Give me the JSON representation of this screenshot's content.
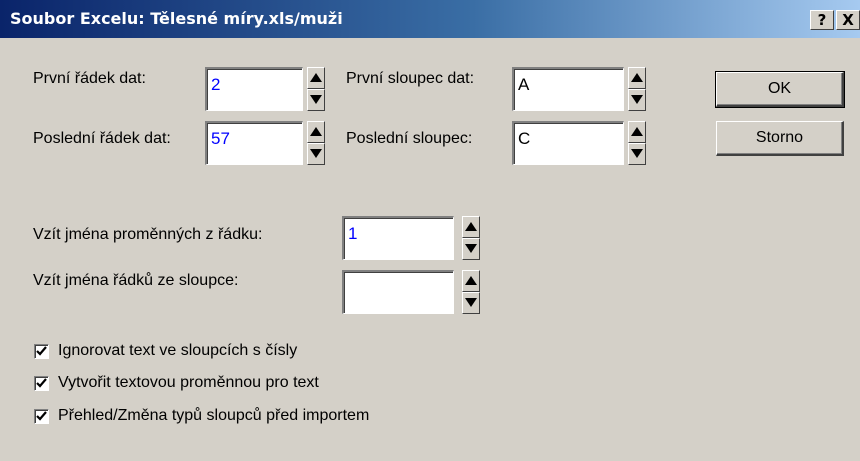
{
  "window": {
    "title": "Soubor Excelu: Tělesné míry.xls/muži",
    "help_label": "?",
    "close_label": "X"
  },
  "fields": {
    "first_row": {
      "label": "První řádek dat:",
      "value": "2"
    },
    "last_row": {
      "label": "Poslední řádek dat:",
      "value": "57"
    },
    "first_column": {
      "label": "První sloupec dat:",
      "value": "A"
    },
    "last_column": {
      "label": "Poslední sloupec:",
      "value": "C"
    },
    "var_names_row": {
      "label": "Vzít jména proměnných z řádku:",
      "value": "1"
    },
    "row_names_column": {
      "label": "Vzít jména řádků ze sloupce:",
      "value": ""
    }
  },
  "buttons": {
    "ok": "OK",
    "cancel": "Storno"
  },
  "checkboxes": [
    {
      "label": "Ignorovat text ve sloupcích s čísly",
      "checked": true
    },
    {
      "label": "Vytvořit textovou proměnnou pro text",
      "checked": true
    },
    {
      "label": "Přehled/Změna typů sloupců před importem",
      "checked": true
    }
  ],
  "icons": {
    "spin_up": "triangle-up-icon",
    "spin_down": "triangle-down-icon",
    "check": "checkmark-icon"
  }
}
